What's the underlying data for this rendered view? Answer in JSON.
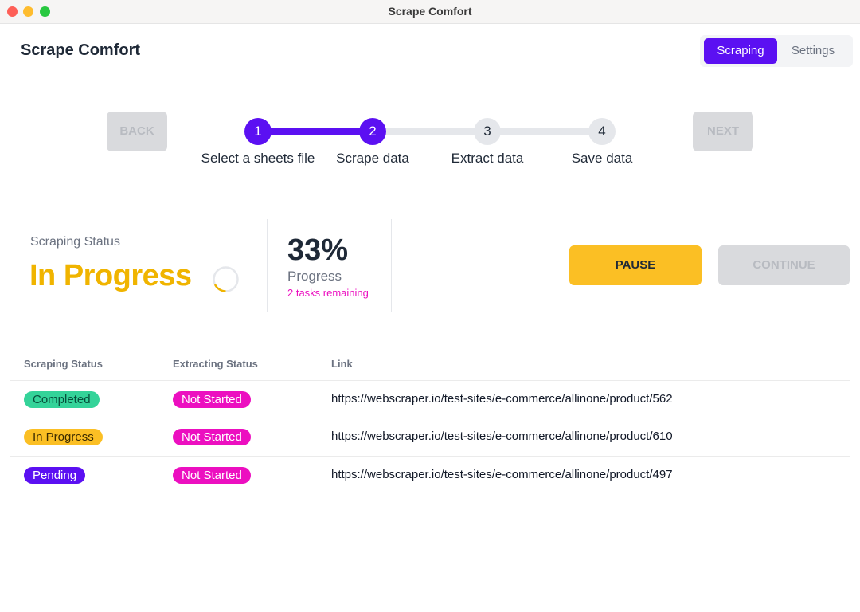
{
  "window": {
    "title": "Scrape Comfort"
  },
  "header": {
    "title": "Scrape Comfort",
    "tabs": [
      {
        "label": "Scraping",
        "active": true
      },
      {
        "label": "Settings",
        "active": false
      }
    ]
  },
  "stepper": {
    "back_label": "BACK",
    "next_label": "NEXT",
    "current_step": 2,
    "steps": [
      {
        "number": "1",
        "label": "Select a sheets file"
      },
      {
        "number": "2",
        "label": "Scrape data"
      },
      {
        "number": "3",
        "label": "Extract data"
      },
      {
        "number": "4",
        "label": "Save data"
      }
    ]
  },
  "status": {
    "label": "Scraping Status",
    "value": "In Progress",
    "percent": "33%",
    "progress_label": "Progress",
    "remaining": "2 tasks remaining"
  },
  "actions": {
    "pause_label": "PAUSE",
    "continue_label": "CONTINUE"
  },
  "table": {
    "headers": [
      "Scraping Status",
      "Extracting Status",
      "Link"
    ],
    "rows": [
      {
        "scraping": "Completed",
        "extracting": "Not Started",
        "link": "https://webscraper.io/test-sites/e-commerce/allinone/product/562"
      },
      {
        "scraping": "In Progress",
        "extracting": "Not Started",
        "link": "https://webscraper.io/test-sites/e-commerce/allinone/product/610"
      },
      {
        "scraping": "Pending",
        "extracting": "Not Started",
        "link": "https://webscraper.io/test-sites/e-commerce/allinone/product/497"
      }
    ]
  },
  "colors": {
    "accent": "#5b10f2",
    "in_progress": "#f0b400",
    "completed": "#34d399",
    "pending": "#5b10f2",
    "not_started": "#ec0fc0",
    "pause": "#fbbf24"
  }
}
